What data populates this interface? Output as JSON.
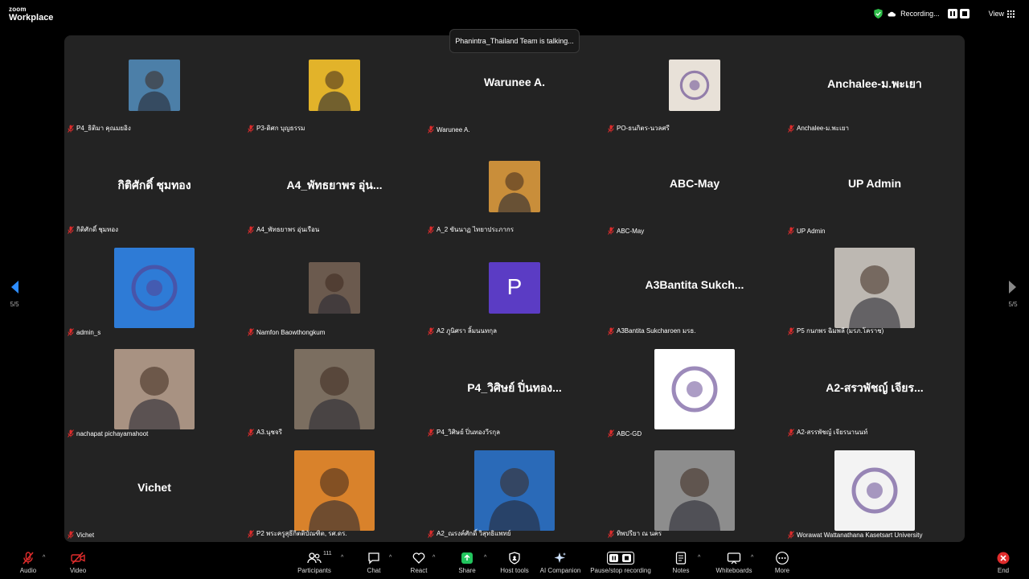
{
  "app": {
    "logo_line1": "zoom",
    "logo_line2": "Workplace"
  },
  "topbar": {
    "recording_label": "Recording...",
    "view_label": "View"
  },
  "talking": "Phanintra_Thailand Team is talking...",
  "pagination": {
    "left": "5/5",
    "right": "5/5"
  },
  "tiles": [
    {
      "label": "P4_ธิติมา คุณมยอิง",
      "display_name": "",
      "avatar": "photo",
      "avatar_color": "#4c7fa8"
    },
    {
      "label": "P3-ดิศก บุญธรรม",
      "display_name": "",
      "avatar": "photo",
      "avatar_color": "#e2b32a"
    },
    {
      "label": "Warunee A.",
      "display_name": "Warunee A.",
      "avatar": "none"
    },
    {
      "label": "PO-ธนกิตร-นวลศรี",
      "display_name": "",
      "avatar": "logo",
      "avatar_color": "#e8e1d8"
    },
    {
      "label": "Anchalee-ม.พะเยา",
      "display_name": "Anchalee-ม.พะเยา",
      "avatar": "none"
    },
    {
      "label": "กิติศักดิ์ ชุมทอง",
      "display_name": "กิติศักดิ์ ชุมทอง",
      "avatar": "none"
    },
    {
      "label": "A4_พัทธยาพร อุ่นเรือน",
      "display_name": "A4_พัทธยาพร อุ่น...",
      "avatar": "none"
    },
    {
      "label": "A_2 ขันนาฏ ไทยาประภากร",
      "display_name": "",
      "avatar": "photo",
      "avatar_color": "#c98e3a"
    },
    {
      "label": "ABC-May",
      "display_name": "ABC-May",
      "avatar": "none"
    },
    {
      "label": "UP Admin",
      "display_name": "UP Admin",
      "avatar": "none"
    },
    {
      "label": "admin_s",
      "display_name": "",
      "avatar": "logo",
      "avatar_color": "#2e7bd6"
    },
    {
      "label": "Namfon Baowthongkum",
      "display_name": "",
      "avatar": "photo",
      "avatar_color": "#6b5a4e"
    },
    {
      "label": "A2 ภูนิศรา ลิ้มนนทกุล",
      "display_name": "",
      "avatar": "letter",
      "avatar_letter": "P",
      "avatar_color": "#5b3cc4"
    },
    {
      "label": "A3Bantita Sukcharoen มรธ.",
      "display_name": "A3Bantita  Sukch...",
      "avatar": "none"
    },
    {
      "label": "P5 กนกพร ฉิมพลี (มรภ.โคราช)",
      "display_name": "",
      "avatar": "photo",
      "avatar_color": "#bdb8b2"
    },
    {
      "label": "nachapat pichayamahoot",
      "display_name": "",
      "avatar": "photo",
      "avatar_color": "#a89282"
    },
    {
      "label": "A3.นุชจรี",
      "display_name": "",
      "avatar": "photo",
      "avatar_color": "#7b6e60"
    },
    {
      "label": "P4_วิศิษย์ ปิ่นทองวีรกุล",
      "display_name": "P4_วิศิษย์ ปิ่นทอง...",
      "avatar": "none"
    },
    {
      "label": "ABC-GD",
      "display_name": "",
      "avatar": "logo",
      "avatar_color": "#ffffff"
    },
    {
      "label": "A2-สรรพัชญ์ เจียรนานนท์",
      "display_name": "A2-สรวพัชญ์ เจียร...",
      "avatar": "none"
    },
    {
      "label": "Vichet",
      "display_name": "Vichet",
      "avatar": "none"
    },
    {
      "label": "P2 พระครูสุธีกิตติบัณฑิต, รศ.ดร.",
      "display_name": "",
      "avatar": "photo",
      "avatar_color": "#d9822b"
    },
    {
      "label": "A2_ณรงค์ศักดิ์ วิสุทธิแพทย์",
      "display_name": "",
      "avatar": "photo",
      "avatar_color": "#2a6ab8"
    },
    {
      "label": "ทิพปรียา ณ นคร",
      "display_name": "",
      "avatar": "photo",
      "avatar_color": "#8d8d8d"
    },
    {
      "label": "Worawat Wattanathana Kasetsart University",
      "display_name": "",
      "avatar": "logo",
      "avatar_color": "#f3f3f3"
    }
  ],
  "toolbar": {
    "audio": "Audio",
    "video": "Video",
    "participants": "Participants",
    "participants_count": "111",
    "chat": "Chat",
    "react": "React",
    "share": "Share",
    "host_tools": "Host tools",
    "ai_companion": "AI Companion",
    "pause_stop": "Pause/stop recording",
    "notes": "Notes",
    "whiteboards": "Whiteboards",
    "more": "More",
    "end": "End"
  },
  "colors": {
    "share": "#22c55e",
    "end": "#e02c2c",
    "muted_mic": "#e02c2c",
    "recording_shield": "#2fbf4a"
  }
}
